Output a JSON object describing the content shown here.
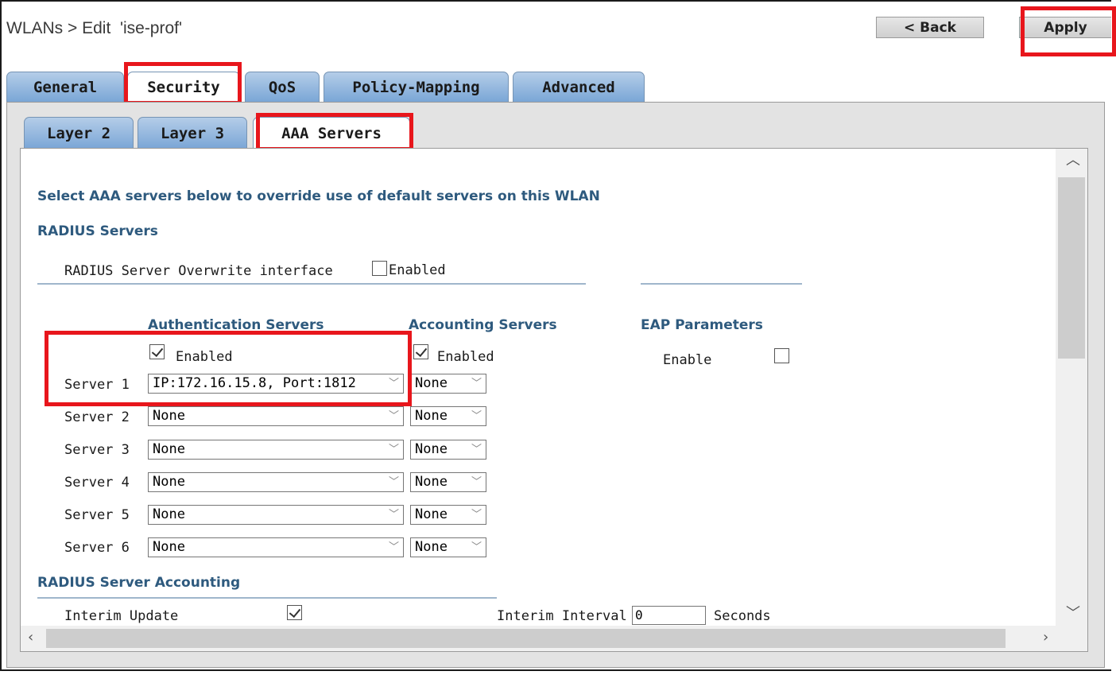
{
  "header": {
    "title": "WLANs > Edit  'ise-prof'",
    "back_label": "< Back",
    "apply_label": "Apply"
  },
  "tabs": [
    "General",
    "Security",
    "QoS",
    "Policy-Mapping",
    "Advanced"
  ],
  "active_tab": "Security",
  "subtabs": [
    "Layer 2",
    "Layer 3",
    "AAA Servers"
  ],
  "active_subtab": "AAA Servers",
  "content": {
    "intro": "Select AAA servers below to override use of default servers on this WLAN",
    "radius_servers_heading": "RADIUS Servers",
    "overwrite_label": "RADIUS Server Overwrite interface",
    "overwrite_enabled_label": "Enabled",
    "overwrite_checked": false,
    "auth_heading": "Authentication Servers",
    "acct_heading": "Accounting Servers",
    "eap_heading": "EAP Parameters",
    "auth_enabled_label": "Enabled",
    "auth_enabled_checked": true,
    "acct_enabled_label": "Enabled",
    "acct_enabled_checked": true,
    "eap_enable_label": "Enable",
    "eap_enable_checked": false,
    "servers": [
      {
        "label": "Server 1",
        "auth": "IP:172.16.15.8, Port:1812",
        "acct": "None"
      },
      {
        "label": "Server 2",
        "auth": "None",
        "acct": "None"
      },
      {
        "label": "Server 3",
        "auth": "None",
        "acct": "None"
      },
      {
        "label": "Server 4",
        "auth": "None",
        "acct": "None"
      },
      {
        "label": "Server 5",
        "auth": "None",
        "acct": "None"
      },
      {
        "label": "Server 6",
        "auth": "None",
        "acct": "None"
      }
    ],
    "accounting_heading": "RADIUS Server Accounting",
    "interim_update_label": "Interim Update",
    "interim_update_checked": true,
    "interim_interval_label": "Interim Interval",
    "interim_interval_value": "0",
    "seconds_label": "Seconds"
  },
  "colors": {
    "highlight": "#e8161c",
    "heading": "#2e5a7e",
    "tab_blue": "#7aa6d6"
  },
  "icons": {
    "chevron_down": "chevron-down-icon",
    "scroll_up": "scroll-up-icon",
    "scroll_down": "scroll-down-icon",
    "scroll_left": "scroll-left-icon",
    "scroll_right": "scroll-right-icon"
  }
}
